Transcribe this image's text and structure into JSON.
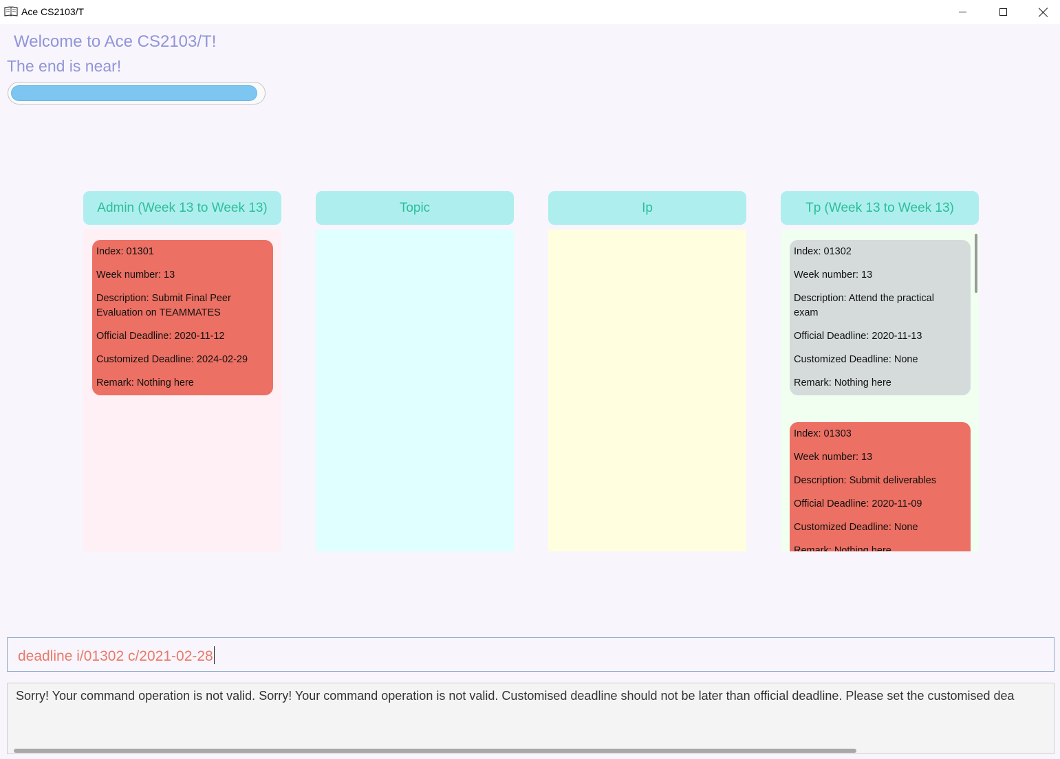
{
  "window": {
    "title": "Ace CS2103/T",
    "icon": "book-icon"
  },
  "header": {
    "welcome": "Welcome to Ace CS2103/T!",
    "subtitle": "The end is near!",
    "progress": 0.98
  },
  "colors": {
    "header_bg": "#afeeee",
    "header_text": "#2bbf98",
    "admin_bg": "#fff0f5",
    "topic_bg": "#e0ffff",
    "ip_bg": "#ffffe0",
    "tp_bg": "#f0fff0",
    "card_red": "#ec7063",
    "card_grey": "#d5dbdb"
  },
  "columns": [
    {
      "title": "Admin (Week 13 to Week 13)",
      "cards": [
        {
          "lines": [
            "Index: 01301",
            "Week number: 13",
            "Description: Submit Final Peer\nEvaluation on TEAMMATES",
            "Official Deadline: 2020-11-12",
            "Customized Deadline: 2024-02-29",
            "Remark: Nothing here"
          ]
        }
      ]
    },
    {
      "title": "Topic",
      "cards": []
    },
    {
      "title": "Ip",
      "cards": []
    },
    {
      "title": "Tp (Week 13 to Week 13)",
      "cards": [
        {
          "lines": [
            "Index: 01302",
            "Week number: 13",
            "Description: Attend the practical\nexam",
            "Official Deadline: 2020-11-13",
            "Customized Deadline: None",
            "Remark: Nothing here"
          ]
        },
        {
          "lines": [
            "Index: 01303",
            "Week number: 13",
            "Description: Submit deliverables",
            "Official Deadline: 2020-11-09",
            "Customized Deadline: None",
            "Remark: Nothing here"
          ]
        }
      ]
    }
  ],
  "command": {
    "value": "deadline i/01302 c/2021-02-28"
  },
  "result": {
    "text": "Sorry! Your command operation is not valid. Sorry! Your command operation is not valid. Customised deadline should not be later than official deadline. Please set the customised dea"
  }
}
